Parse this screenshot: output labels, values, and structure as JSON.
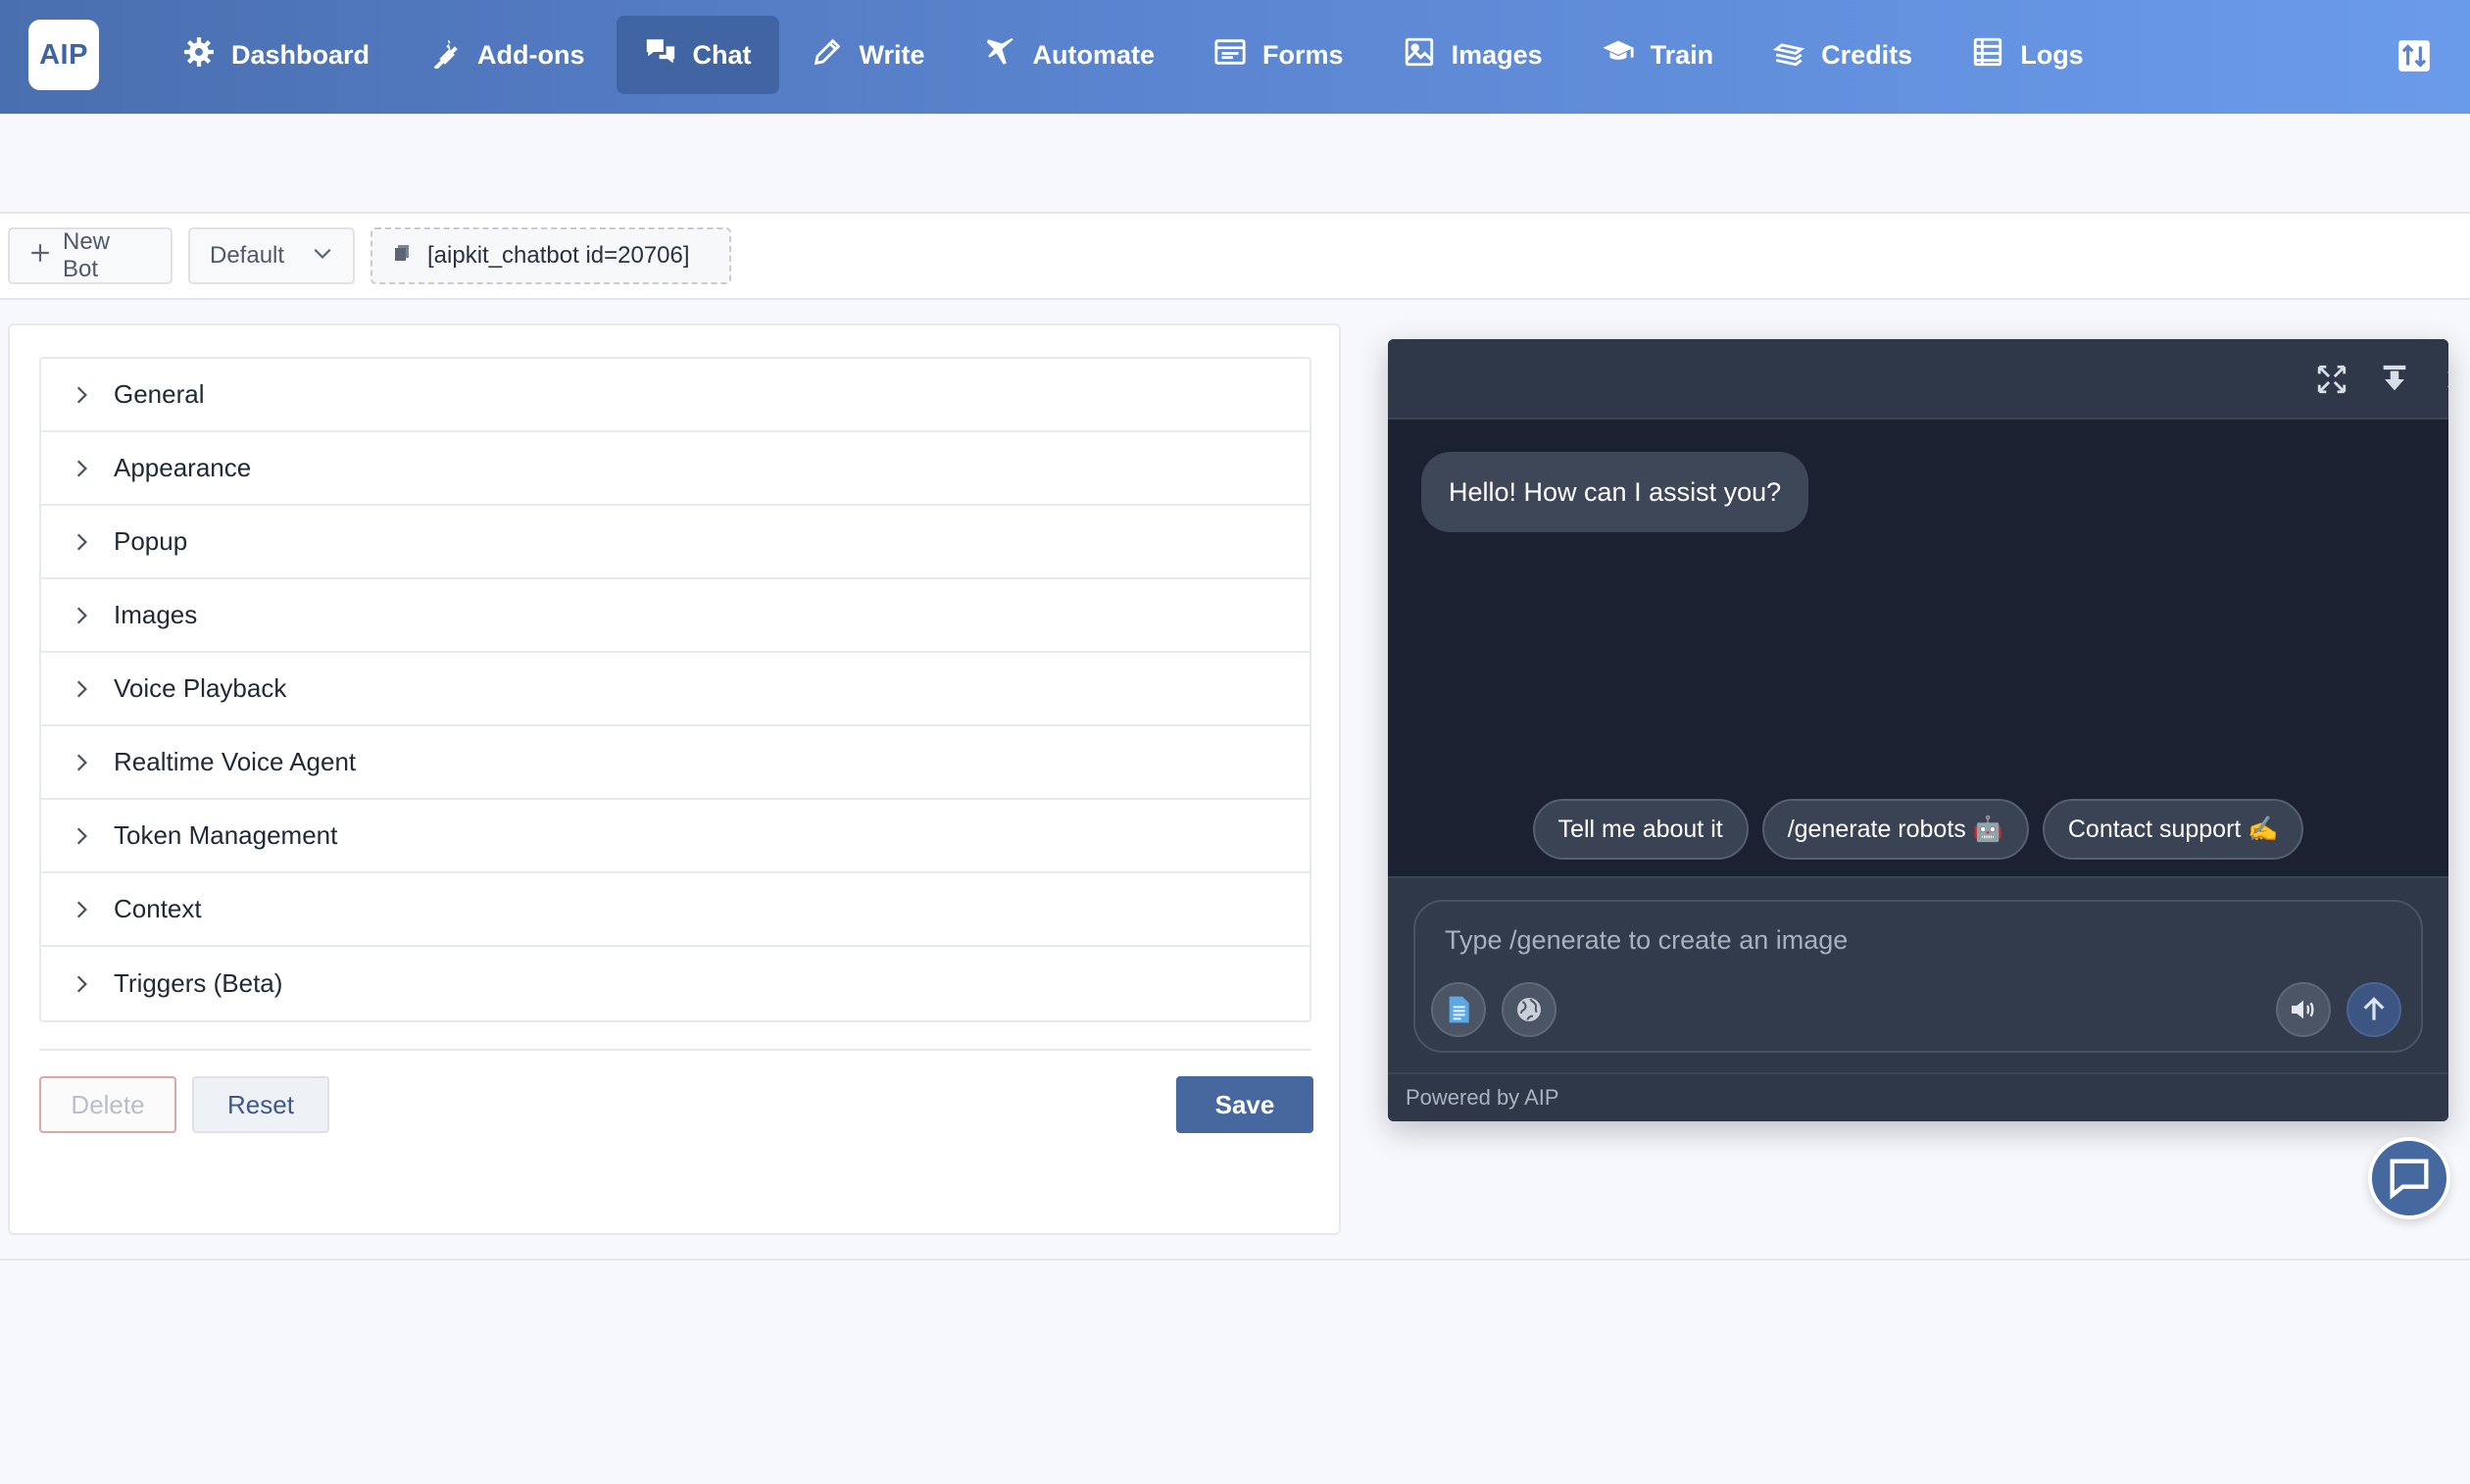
{
  "app": {
    "logo": "AIP"
  },
  "nav": {
    "items": [
      {
        "label": "Dashboard",
        "icon": "gear-icon"
      },
      {
        "label": "Add-ons",
        "icon": "plug-icon"
      },
      {
        "label": "Chat",
        "icon": "chat-icon",
        "active": true
      },
      {
        "label": "Write",
        "icon": "pencil-icon"
      },
      {
        "label": "Automate",
        "icon": "plane-icon"
      },
      {
        "label": "Forms",
        "icon": "form-icon"
      },
      {
        "label": "Images",
        "icon": "image-icon"
      },
      {
        "label": "Train",
        "icon": "graduation-cap-icon"
      },
      {
        "label": "Credits",
        "icon": "coins-icon"
      },
      {
        "label": "Logs",
        "icon": "list-icon"
      }
    ],
    "right_icon": "swap-icon"
  },
  "toolbar": {
    "new_bot_label": "New Bot",
    "bot_select_value": "Default",
    "shortcode": "[aipkit_chatbot id=20706]"
  },
  "settings": {
    "sections": [
      "General",
      "Appearance",
      "Popup",
      "Images",
      "Voice Playback",
      "Realtime Voice Agent",
      "Token Management",
      "Context",
      "Triggers (Beta)"
    ],
    "delete_label": "Delete",
    "reset_label": "Reset",
    "save_label": "Save"
  },
  "chat": {
    "greeting": "Hello! How can I assist you?",
    "suggestions": [
      "Tell me about it",
      "/generate robots 🤖",
      "Contact support ✍️"
    ],
    "input_placeholder": "Type /generate to create an image",
    "footer": "Powered by AIP"
  },
  "colors": {
    "nav_gradient_start": "#4a6fb0",
    "nav_gradient_end": "#6a9bea",
    "primary": "#46689f",
    "chat_bg": "#1b2130",
    "chat_header": "#2f3848"
  }
}
